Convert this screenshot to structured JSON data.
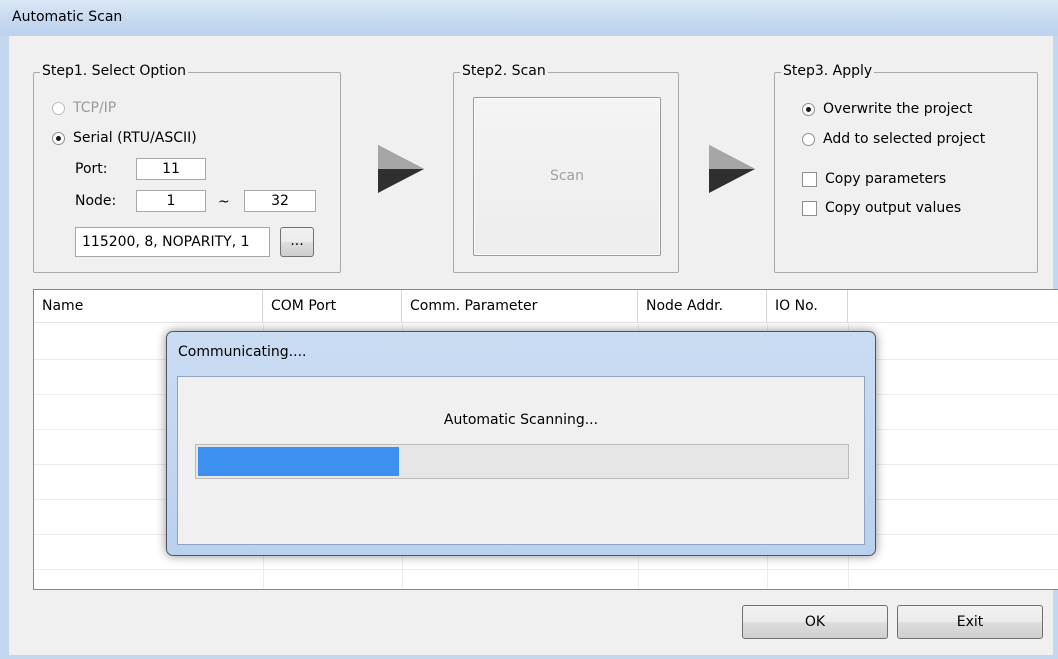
{
  "window": {
    "title": "Automatic Scan"
  },
  "step1": {
    "label": "Step1. Select Option",
    "tcpip": "TCP/IP",
    "serial": "Serial (RTU/ASCII)",
    "port_label": "Port:",
    "port_value": "11",
    "node_label": "Node:",
    "node_from": "1",
    "node_sep": "~",
    "node_to": "32",
    "serial_params": "115200, 8, NOPARITY, 1",
    "browse_label": "..."
  },
  "step2": {
    "label": "Step2. Scan",
    "scan_button": "Scan"
  },
  "step3": {
    "label": "Step3. Apply",
    "overwrite": "Overwrite the project",
    "add": "Add to selected project",
    "copy_params": "Copy parameters",
    "copy_outputs": "Copy output values"
  },
  "list": {
    "columns": [
      "Name",
      "COM Port",
      "Comm. Parameter",
      "Node Addr.",
      "IO No."
    ]
  },
  "buttons": {
    "ok": "OK",
    "exit": "Exit"
  },
  "dialog": {
    "title": "Communicating....",
    "message": "Automatic Scanning...",
    "progress_fraction": 0.31
  },
  "colors": {
    "progress_fill": "#3c91f0",
    "title_bar": "#c6d9f0"
  }
}
